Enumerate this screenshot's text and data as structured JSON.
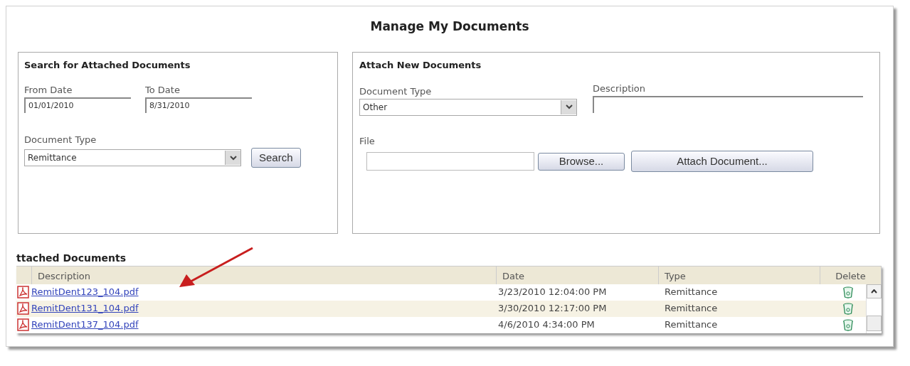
{
  "title": "Manage My Documents",
  "search_panel": {
    "heading": "Search for Attached Documents",
    "from_date": {
      "label": "From Date",
      "value": "01/01/2010"
    },
    "to_date": {
      "label": "To Date",
      "value": "8/31/2010"
    },
    "document_type": {
      "label": "Document Type",
      "value": "Remittance"
    },
    "button": "Search"
  },
  "attach_panel": {
    "heading": "Attach New Documents",
    "document_type": {
      "label": "Document Type",
      "value": "Other"
    },
    "description": {
      "label": "Description"
    },
    "file": {
      "label": "File"
    },
    "browse_button": "Browse...",
    "attach_button": "Attach Document..."
  },
  "attached": {
    "heading": "ttached Documents",
    "columns": [
      "Description",
      "Date",
      "Type",
      "Delete"
    ],
    "rows": [
      {
        "file": "RemitDent123_104.pdf",
        "date": "3/23/2010 12:04:00 PM",
        "type": "Remittance"
      },
      {
        "file": "RemitDent131_104.pdf",
        "date": "3/30/2010 12:17:00 PM",
        "type": "Remittance"
      },
      {
        "file": "RemitDent137_104.pdf",
        "date": "4/6/2010 4:34:00 PM",
        "type": "Remittance"
      }
    ]
  }
}
